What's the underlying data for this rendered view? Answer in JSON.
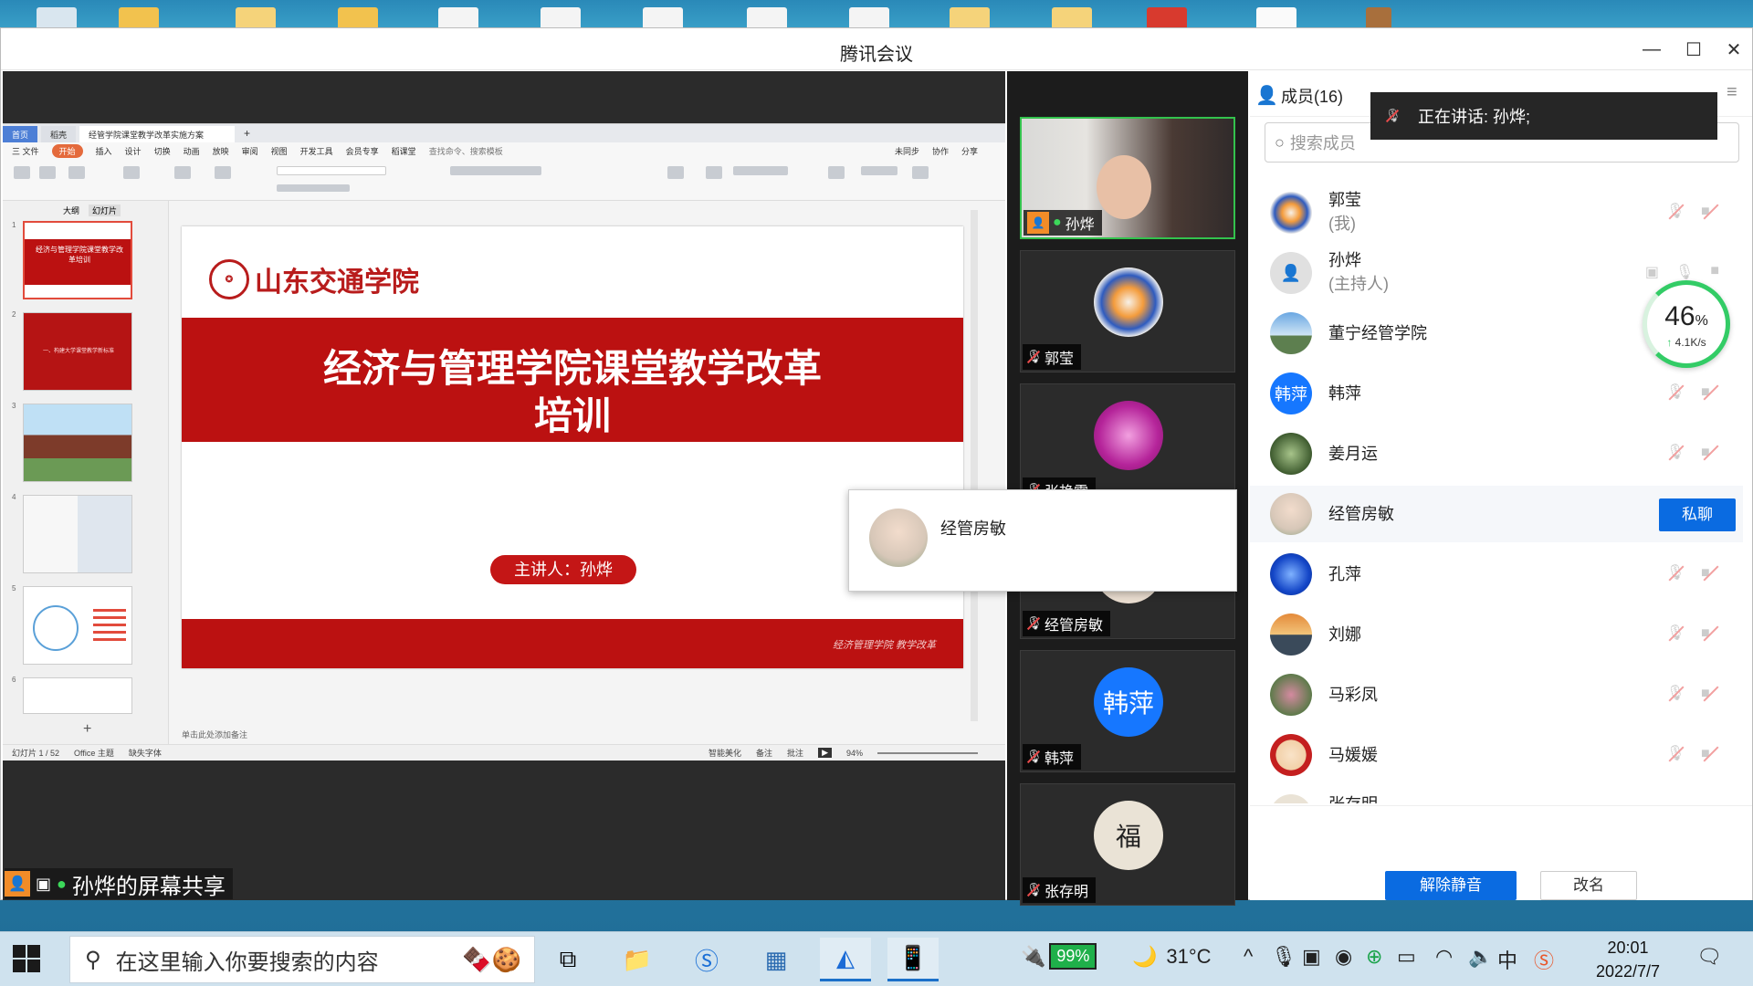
{
  "window": {
    "title": "腾讯会议"
  },
  "wps": {
    "tabs": [
      "首页",
      "稻壳",
      "经管学院课堂教学改革实施方案"
    ],
    "menu": [
      "三 文件",
      "开始",
      "插入",
      "设计",
      "切换",
      "动画",
      "放映",
      "审阅",
      "视图",
      "开发工具",
      "会员专享",
      "稻课堂",
      "查找命令、搜索模板"
    ],
    "ribbon_right": [
      "未同步",
      "协作",
      "分享"
    ],
    "outline_tabs": [
      "大纲",
      "幻灯片"
    ],
    "thumb_title": "经济与管理学院课堂教学改革培训",
    "thumb2_text": "一、构建大学课堂教学新标准",
    "slide": {
      "school_name": "山东交通学院",
      "title_line1": "经济与管理学院课堂教学改革",
      "title_line2": "培训",
      "speaker": "主讲人：孙烨",
      "footer_script": "经济管理学院 教学改革"
    },
    "notes_hint": "单击此处添加备注",
    "status_left": "幻灯片 1 / 52",
    "status_theme": "Office 主题",
    "status_font": "缺失字体",
    "status_right": [
      "智能美化",
      "备注",
      "批注"
    ],
    "zoom": "94%"
  },
  "share_label": "孙烨的屏幕共享",
  "videos": [
    {
      "name": "孙烨",
      "active": true
    },
    {
      "name": "郭莹"
    },
    {
      "name": "张艳雪"
    },
    {
      "name": "经管房敏"
    },
    {
      "name": "韩萍",
      "avatar_text": "韩萍"
    },
    {
      "name": "张存明"
    }
  ],
  "popup": {
    "name": "经管房敏"
  },
  "panel": {
    "title": "成员(16)",
    "search_placeholder": "搜索成员",
    "speaking": "正在讲话: 孙烨;",
    "network": {
      "percent": "46",
      "percent_sign": "%",
      "speed": "4.1K/s"
    },
    "members": [
      {
        "name": "郭莹",
        "role": "(我)"
      },
      {
        "name": "孙烨",
        "role": "(主持人)"
      },
      {
        "name": "董宁经管学院"
      },
      {
        "name": "韩萍",
        "avatar_text": "韩萍"
      },
      {
        "name": "姜月运"
      },
      {
        "name": "经管房敏",
        "action": "私聊"
      },
      {
        "name": "孔萍"
      },
      {
        "name": "刘娜"
      },
      {
        "name": "马彩凤"
      },
      {
        "name": "马媛媛"
      },
      {
        "name": "张存明"
      }
    ],
    "unmute_btn": "解除静音",
    "rename_btn": "改名"
  },
  "taskbar": {
    "search_placeholder": "在这里输入你要搜索的内容",
    "battery": "99%",
    "temperature": "31°C",
    "time": "20:01",
    "date": "2022/7/7"
  }
}
